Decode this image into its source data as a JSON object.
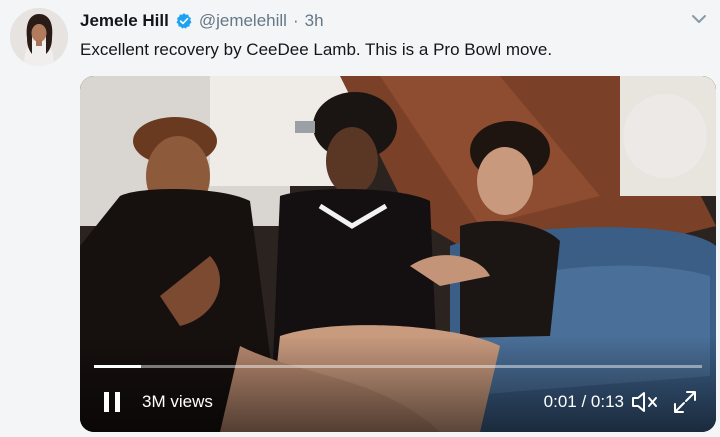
{
  "tweet": {
    "author_name": "Jemele Hill",
    "handle": "@jemelehill",
    "separator": "·",
    "time": "3h",
    "text": "Excellent recovery by CeeDee Lamb. This is a Pro Bowl move."
  },
  "icons": {
    "verified": "verified-badge-icon",
    "menu": "chevron-down-icon",
    "pause": "pause-icon",
    "mute": "volume-muted-icon",
    "expand": "fullscreen-icon"
  },
  "video": {
    "views": "3M views",
    "timecode": "0:01 / 0:13",
    "progress": 0.077
  },
  "colors": {
    "accent": "#1da1f2",
    "text": "#14171a",
    "muted": "#657786"
  }
}
